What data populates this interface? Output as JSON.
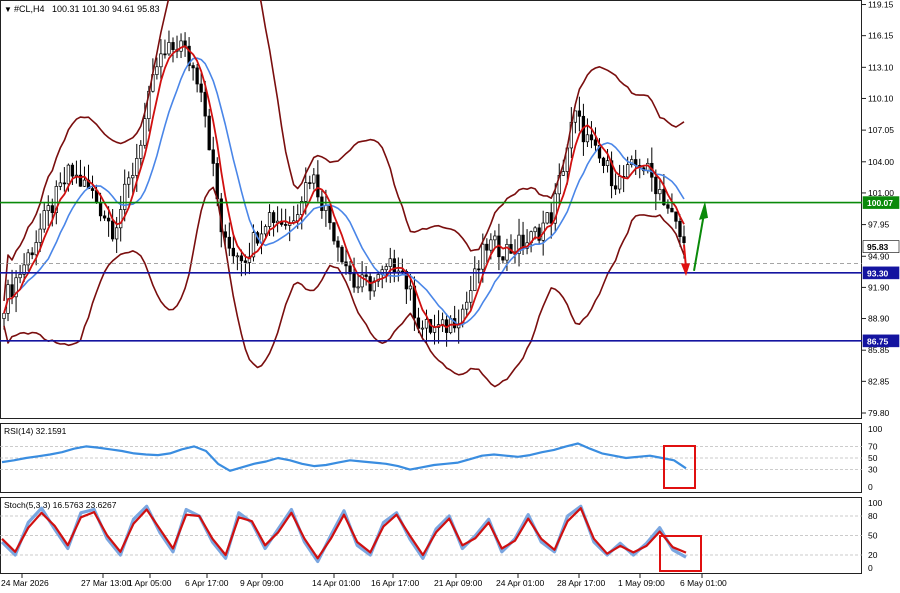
{
  "symbol_header": {
    "menu_glyph": "▼",
    "symbol": "#CL,H4",
    "ohlc": "100.31 101.30 94.61 95.83"
  },
  "colors": {
    "bull_candle": "#000000",
    "bear_candle": "#000000",
    "bollinger": "#7a0e0e",
    "ma_fast": "#d01010",
    "ma_slow": "#4a86e8",
    "level_green": "#0a8a0a",
    "level_blue": "#1414a0",
    "current_price_tag": "#000000",
    "rsi": "#3a8de0",
    "stoch_main": "#7aa6e0",
    "stoch_signal": "#d01010",
    "highlight_box": "#e01010",
    "arrow_up": "#0a8a0a",
    "arrow_down": "#e01010"
  },
  "chart_data": [
    {
      "type": "candlestick",
      "panel": "price",
      "ylim": [
        79.8,
        119.2
      ],
      "y_ticks": [
        "119.15",
        "116.15",
        "113.10",
        "110.10",
        "107.05",
        "104.00",
        "101.00",
        "97.95",
        "94.90",
        "91.90",
        "88.90",
        "85.85",
        "82.85",
        "79.80"
      ],
      "price_tags": [
        {
          "label": "100.07",
          "value": 100.07,
          "kind": "green_level"
        },
        {
          "label": "95.83",
          "value": 95.83,
          "kind": "current"
        },
        {
          "label": "93.30",
          "value": 93.3,
          "kind": "blue_level"
        },
        {
          "label": "86.75",
          "value": 86.75,
          "kind": "blue_level"
        }
      ],
      "horizontal_levels": [
        100.07,
        93.3,
        86.75
      ],
      "close_path": [
        90.5,
        94.5,
        99,
        103,
        101,
        97.5,
        104,
        113.5,
        115.5,
        111.5,
        96,
        95,
        99,
        98,
        103,
        97.5,
        92,
        92.5,
        94.5,
        88,
        87.8,
        90,
        96,
        95.5,
        96.5,
        99,
        108.5,
        104.5,
        102,
        104,
        101,
        95.83
      ],
      "x_tick_labels": [
        "24 Mar 2026",
        "27 Mar 13:00",
        "1 Apr 05:00",
        "6 Apr 17:00",
        "9 Apr 09:00",
        "14 Apr 01:00",
        "16 Apr 17:00",
        "21 Apr 09:00",
        "24 Apr 01:00",
        "28 Apr 17:00",
        "1 May 09:00",
        "6 May 01:00"
      ]
    },
    {
      "type": "line",
      "panel": "rsi",
      "label": "RSI(14) 32.1591",
      "ylim": [
        0,
        100
      ],
      "y_ticks": [
        "100",
        "70",
        "50",
        "30",
        "0"
      ],
      "levels": [
        70,
        50,
        30
      ],
      "values": [
        43,
        46,
        50,
        53,
        56,
        60,
        66,
        70,
        68,
        65,
        62,
        58,
        56,
        55,
        58,
        65,
        70,
        62,
        40,
        28,
        34,
        40,
        44,
        50,
        46,
        40,
        36,
        38,
        42,
        46,
        44,
        42,
        40,
        36,
        30,
        34,
        38,
        40,
        42,
        48,
        54,
        56,
        54,
        52,
        55,
        60,
        64,
        70,
        75,
        66,
        58,
        54,
        50,
        52,
        54,
        50,
        46,
        32.16
      ]
    },
    {
      "type": "line",
      "panel": "stochastic",
      "label": "Stoch(5,3,3) 16.5763 23.6267",
      "ylim": [
        0,
        100
      ],
      "y_ticks": [
        "100",
        "80",
        "50",
        "20",
        "0"
      ],
      "levels": [
        80,
        50,
        20
      ],
      "series": [
        {
          "name": "16.5763",
          "values": [
            40,
            20,
            70,
            92,
            60,
            30,
            85,
            90,
            45,
            20,
            75,
            95,
            55,
            25,
            90,
            80,
            40,
            15,
            85,
            70,
            30,
            60,
            90,
            40,
            10,
            50,
            88,
            35,
            20,
            70,
            85,
            45,
            15,
            60,
            80,
            30,
            50,
            75,
            25,
            45,
            82,
            40,
            25,
            80,
            95,
            40,
            20,
            38,
            20,
            38,
            62,
            28,
            16.58
          ]
        },
        {
          "name": "23.6267",
          "values": [
            45,
            25,
            62,
            85,
            65,
            35,
            78,
            86,
            50,
            25,
            68,
            90,
            60,
            30,
            82,
            80,
            45,
            20,
            78,
            72,
            35,
            55,
            85,
            45,
            15,
            45,
            82,
            40,
            24,
            64,
            82,
            50,
            20,
            55,
            76,
            35,
            46,
            70,
            30,
            42,
            76,
            45,
            28,
            72,
            92,
            45,
            22,
            34,
            24,
            34,
            56,
            32,
            23.63
          ]
        }
      ]
    }
  ]
}
